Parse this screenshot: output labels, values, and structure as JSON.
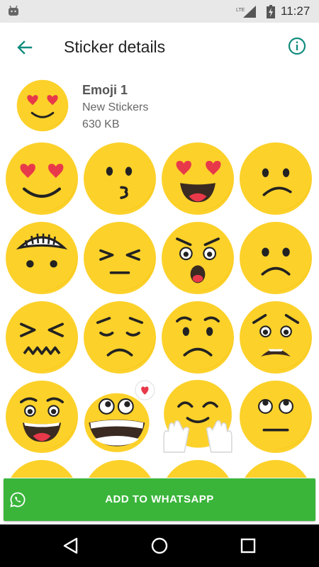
{
  "status_bar": {
    "time": "11:27",
    "network": "LTE"
  },
  "app_bar": {
    "title": "Sticker details"
  },
  "pack": {
    "name": "Emoji 1",
    "publisher": "New Stickers",
    "size": "630 KB"
  },
  "stickers": [
    "heart-eyes-smile",
    "kissing",
    "heart-eyes-grin",
    "confused",
    "grimacing",
    "persevering",
    "astonished-angry",
    "frowning",
    "tired",
    "pensive",
    "sad-frown",
    "anguished",
    "grinning-happy",
    "crazy-love",
    "hugging",
    "eye-roll"
  ],
  "add_button": {
    "label": "ADD TO WHATSAPP"
  },
  "colors": {
    "accent": "#128c7e",
    "button": "#3ab53a",
    "emoji": "#fcd12a"
  }
}
